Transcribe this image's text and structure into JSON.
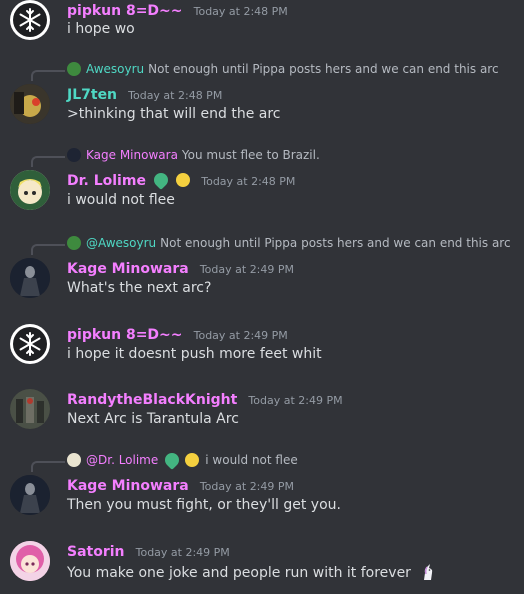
{
  "messages": [
    {
      "author": "pipkun 8=D~~",
      "timestamp": "Today at 2:48 PM",
      "text": "i hope wo"
    },
    {
      "reply": {
        "author": "Awesoyru",
        "text": "Not enough until Pippa posts hers and we can end this arc"
      },
      "author": "JL7ten",
      "timestamp": "Today at 2:48 PM",
      "text": ">thinking that will end the arc"
    },
    {
      "reply": {
        "author": "Kage Minowara",
        "text": "You must flee to Brazil."
      },
      "author": "Dr. Lolime",
      "timestamp": "Today at 2:48 PM",
      "text": "i would not flee",
      "author_badges": [
        "green-heart-emoji",
        "lemon-emoji"
      ]
    },
    {
      "reply": {
        "author": "@Awesoyru",
        "text": "Not enough until Pippa posts hers and we can end this arc"
      },
      "author": "Kage Minowara",
      "timestamp": "Today at 2:49 PM",
      "text": "What's the next arc?"
    },
    {
      "author": "pipkun 8=D~~",
      "timestamp": "Today at 2:49 PM",
      "text": "i hope it doesnt push more feet whit"
    },
    {
      "author": "RandytheBlackKnight",
      "timestamp": "Today at 2:49 PM",
      "text": "Next Arc is Tarantula Arc"
    },
    {
      "reply": {
        "author": "@Dr. Lolime",
        "text": "i would not flee"
      },
      "author": "Kage Minowara",
      "timestamp": "Today at 2:49 PM",
      "text": "Then you must fight, or they'll get you."
    },
    {
      "author": "Satorin",
      "timestamp": "Today at 2:49 PM",
      "text": "You make one joke and people run with it forever",
      "trailing_emoji": "unicorn-emoji"
    }
  ],
  "colors": {
    "background": "#313338",
    "author": "#f47fff",
    "teal": "#4fd8c4",
    "timestamp": "#949ba4"
  }
}
